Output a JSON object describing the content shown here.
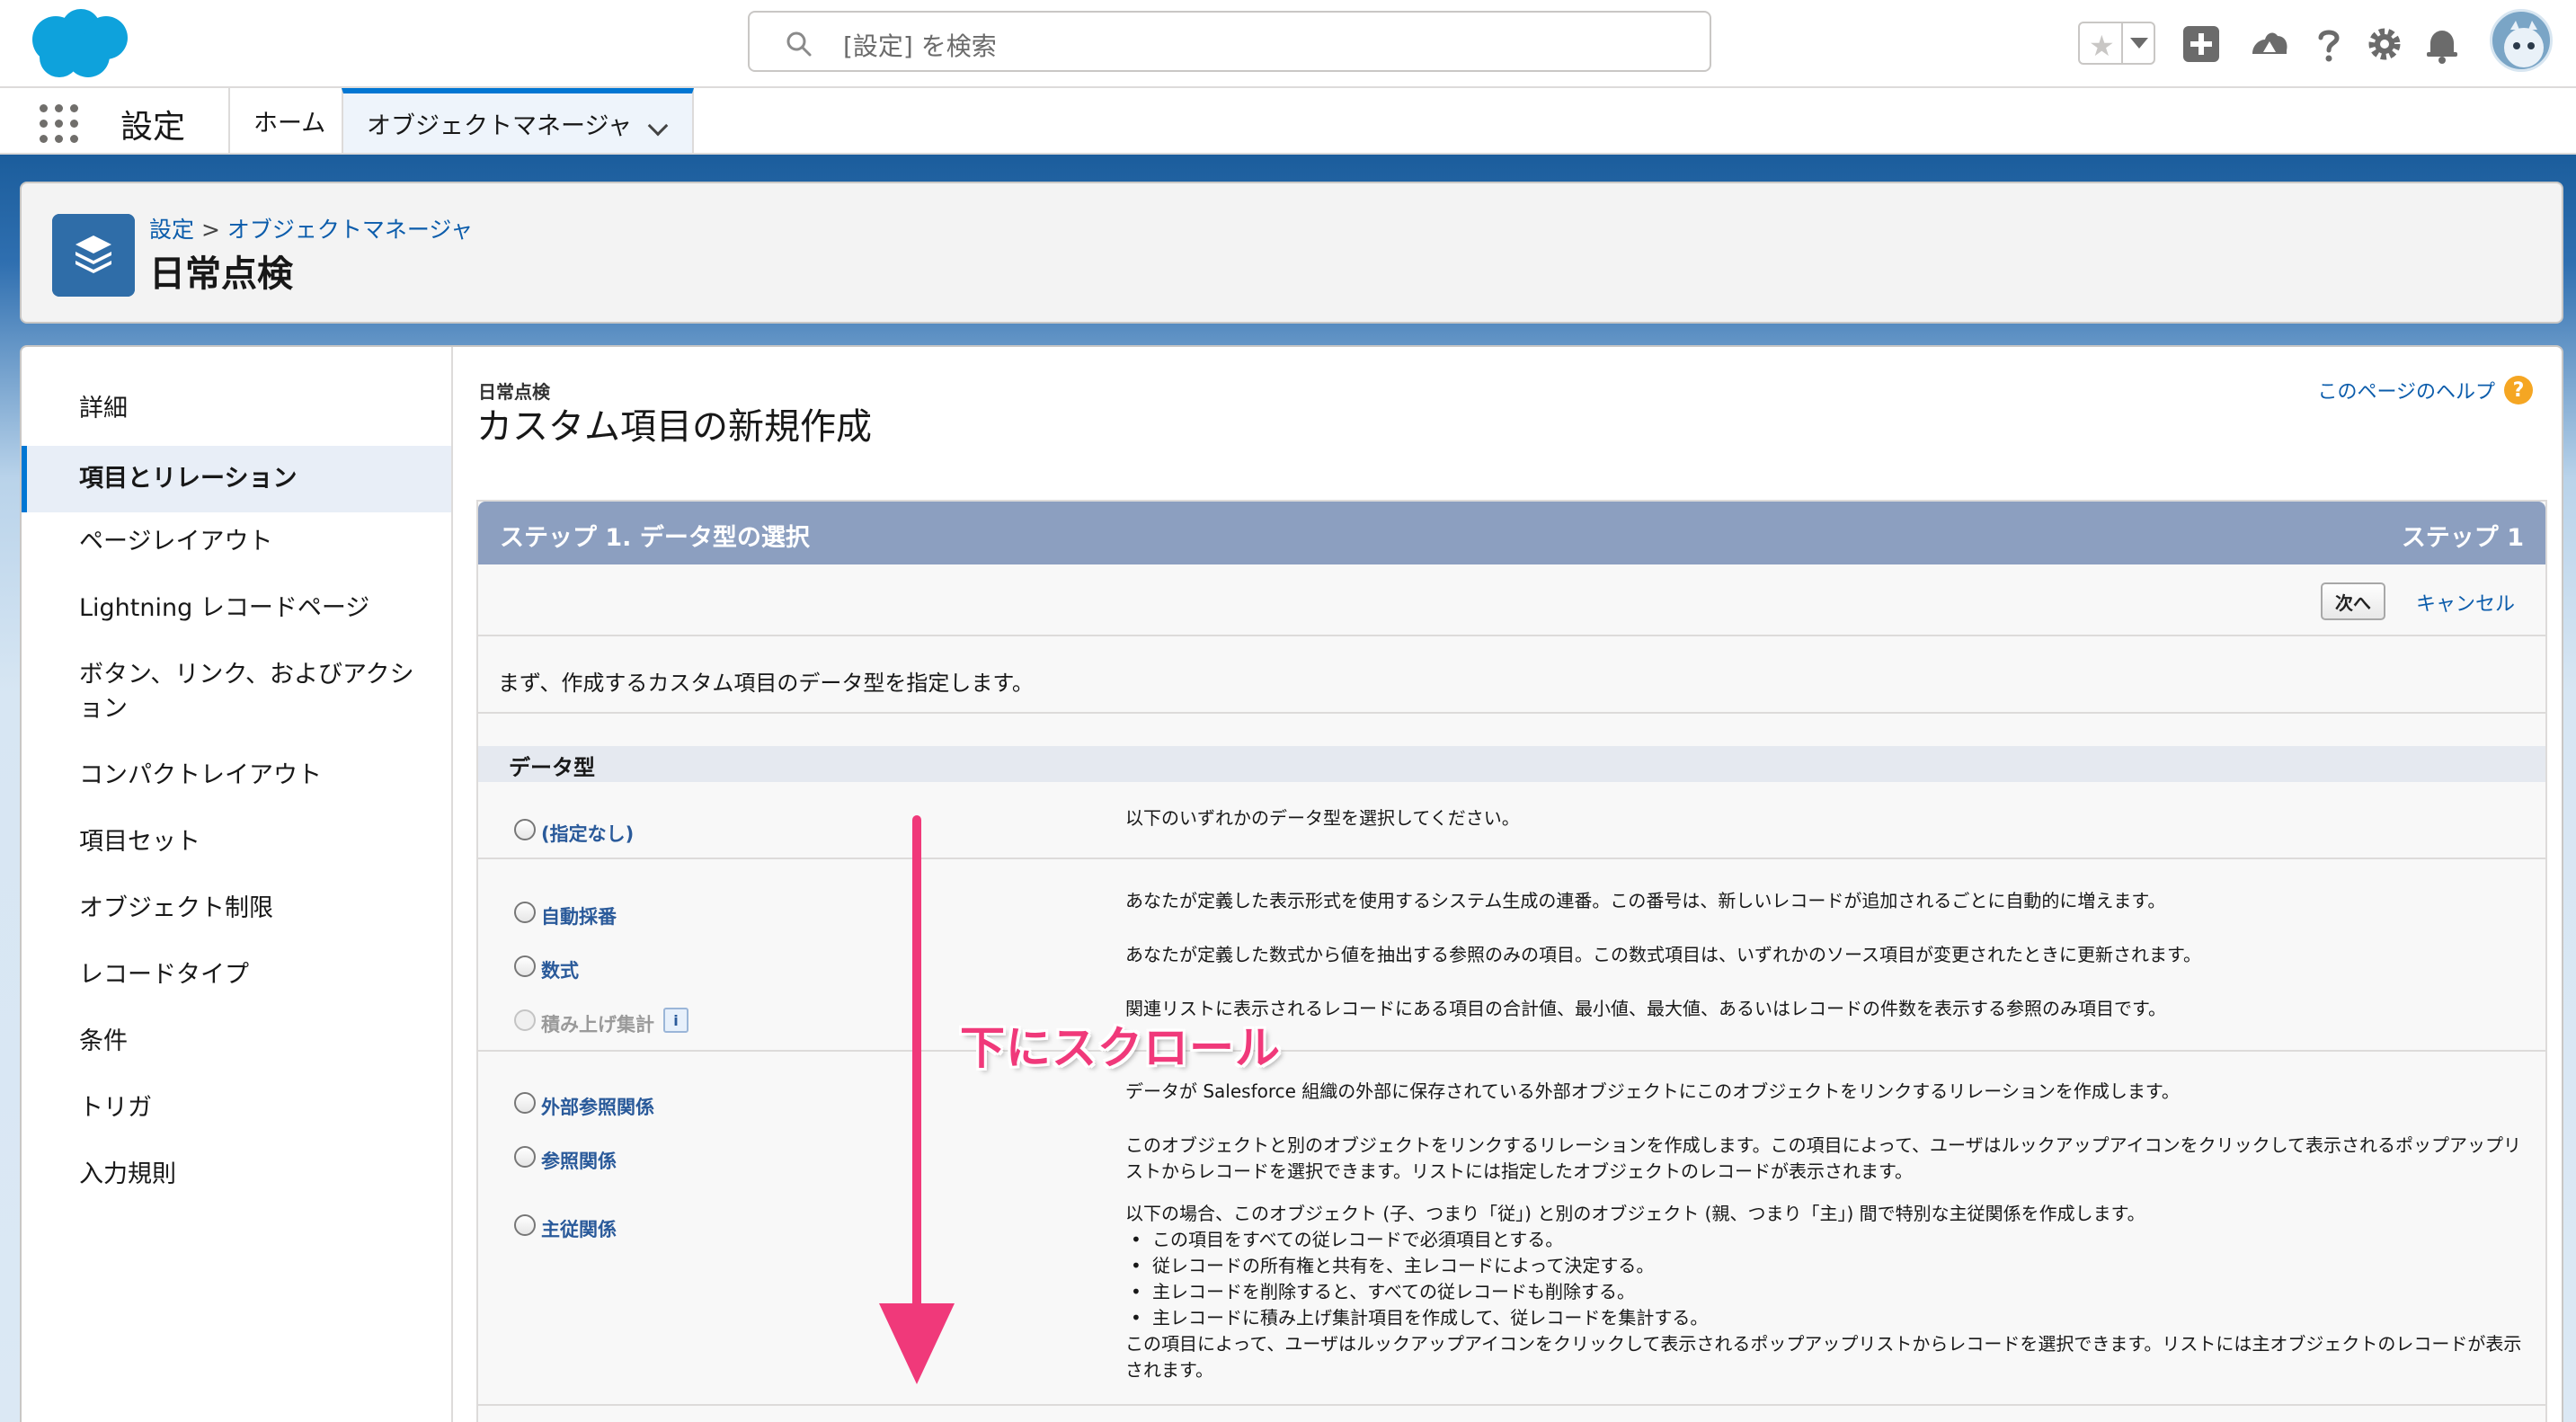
{
  "header": {
    "search_placeholder": "[設定] を検索",
    "icons": [
      "salesforce-cloud-logo",
      "search-icon",
      "favorites-star-icon",
      "add-icon",
      "trailhead-icon",
      "help-icon",
      "gear-icon",
      "bell-icon",
      "avatar"
    ]
  },
  "nav": {
    "app_name": "設定",
    "tabs": [
      {
        "label": "ホーム"
      },
      {
        "label": "オブジェクトマネージャ",
        "active": true
      }
    ]
  },
  "page_header": {
    "breadcrumb_setup": "設定",
    "breadcrumb_sep": ">",
    "breadcrumb_om": "オブジェクトマネージャ",
    "title": "日常点検"
  },
  "sidebar": {
    "items": [
      {
        "label": "詳細"
      },
      {
        "label": "項目とリレーション",
        "active": true
      },
      {
        "label": "ページレイアウト"
      },
      {
        "label": "Lightning レコードページ"
      },
      {
        "label": "ボタン、リンク、およびアクション"
      },
      {
        "label": "コンパクトレイアウト"
      },
      {
        "label": "項目セット"
      },
      {
        "label": "オブジェクト制限"
      },
      {
        "label": "レコードタイプ"
      },
      {
        "label": "条件"
      },
      {
        "label": "トリガ"
      },
      {
        "label": "入力規則"
      }
    ]
  },
  "content": {
    "object_label": "日常点検",
    "title": "カスタム項目の新規作成",
    "help_link": "このページのヘルプ",
    "step_title": "ステップ 1. データ型の選択",
    "step_indicator": "ステップ 1",
    "next_button": "次へ",
    "cancel_link": "キャンセル",
    "intro": "まず、作成するカスタム項目のデータ型を指定します。",
    "data_type_header": "データ型",
    "options": [
      {
        "label": "(指定なし)",
        "desc": "以下のいずれかのデータ型を選択してください。"
      },
      {
        "label": "自動採番",
        "desc": "あなたが定義した表示形式を使用するシステム生成の連番。この番号は、新しいレコードが追加されるごとに自動的に増えます。"
      },
      {
        "label": "数式",
        "desc": "あなたが定義した数式から値を抽出する参照のみの項目。この数式項目は、いずれかのソース項目が変更されたときに更新されます。"
      },
      {
        "label": "積み上げ集計",
        "disabled": true,
        "info": "i",
        "desc": "関連リストに表示されるレコードにある項目の合計値、最小値、最大値、あるいはレコードの件数を表示する参照のみ項目です。"
      },
      {
        "label": "外部参照関係",
        "desc": "データが Salesforce 組織の外部に保存されている外部オブジェクトにこのオブジェクトをリンクするリレーションを作成します。"
      },
      {
        "label": "参照関係",
        "desc": "このオブジェクトと別のオブジェクトをリンクするリレーションを作成します。この項目によって、ユーザはルックアップアイコンをクリックして表示されるポップアップリストからレコードを選択できます。リストには指定したオブジェクトのレコードが表示されます。"
      },
      {
        "label": "主従関係",
        "desc": "以下の場合、このオブジェクト (子、つまり「従」) と別のオブジェクト (親、つまり「主」) 間で特別な主従関係を作成します。",
        "bullets": [
          "この項目をすべての従レコードで必須項目とする。",
          "従レコードの所有権と共有を、主レコードによって決定する。",
          "主レコードを削除すると、すべての従レコードも削除する。",
          "主レコードに積み上げ集計項目を作成して、従レコードを集計する。"
        ],
        "desc_after": "この項目によって、ユーザはルックアップアイコンをクリックして表示されるポップアップリストからレコードを選択できます。リストには主オブジェクトのレコードが表示されます。"
      }
    ]
  },
  "annotation": {
    "text": "下にスクロール",
    "color": "#f0397a"
  },
  "colors": {
    "accent": "#0176d3",
    "link": "#0b5cab",
    "step_bar": "#8c9fc0",
    "object_icon": "#2f6da8"
  }
}
